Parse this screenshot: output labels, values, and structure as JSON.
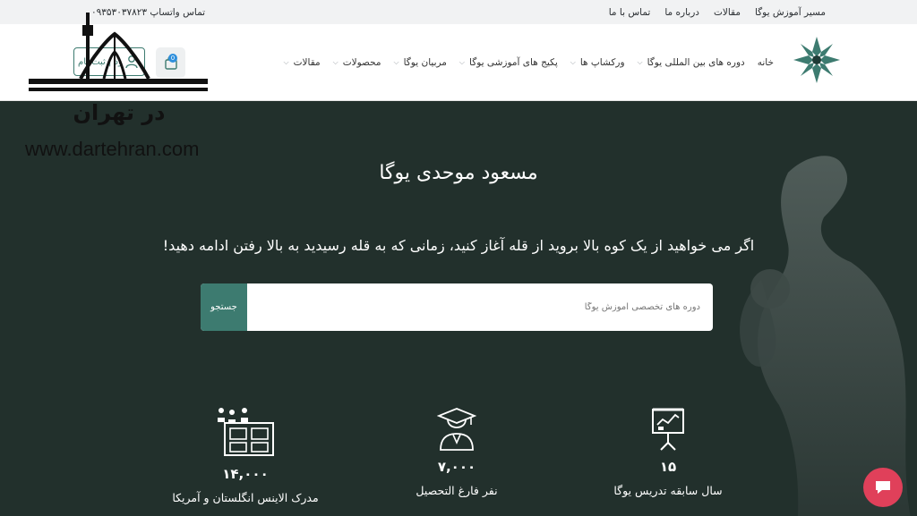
{
  "topbar": {
    "links": [
      "مسیر آموزش یوگا",
      "مقالات",
      "درباره ما",
      "تماس با ما"
    ],
    "contact": "تماس واتساپ ۰۹۳۵۳۰۳۷۸۲۳"
  },
  "nav": {
    "items": [
      {
        "label": "خانه",
        "dropdown": false
      },
      {
        "label": "دوره های بین المللی یوگا",
        "dropdown": true
      },
      {
        "label": "ورکشاپ ها",
        "dropdown": true
      },
      {
        "label": "پکیج های آموزشی یوگا",
        "dropdown": true
      },
      {
        "label": "مربیان یوگا",
        "dropdown": true
      },
      {
        "label": "محصولات",
        "dropdown": true
      },
      {
        "label": "مقالات",
        "dropdown": true
      }
    ],
    "login_label": "ورود | ثبت نام",
    "cart_count": "0"
  },
  "watermark": {
    "logo_text": "در تهران",
    "url": "www.dartehran.com"
  },
  "hero": {
    "title": "مسعود موحدی یوگا",
    "subtitle": "اگر می خواهید از یک کوه بالا بروید از قله آغاز کنید، زمانی که به قله رسیدید به بالا رفتن ادامه دهید!",
    "search_placeholder": "دوره های تخصصی آموزش یوگا",
    "search_button": "جستجو"
  },
  "stats": [
    {
      "value": "۱۵",
      "label": "سال سابقه تدریس یوگا",
      "icon": "presentation-icon"
    },
    {
      "value": "۷,۰۰۰",
      "label": "نفر فارغ التحصیل",
      "icon": "graduate-icon"
    },
    {
      "value": "۱۴,۰۰۰",
      "label": "مدرک الاینس انگلستان و آمریکا",
      "icon": "certificate-board-icon"
    }
  ],
  "colors": {
    "hero_bg": "#22302c",
    "accent": "#3d7b70",
    "chat": "#e0405a",
    "badge": "#2f8fdc"
  }
}
